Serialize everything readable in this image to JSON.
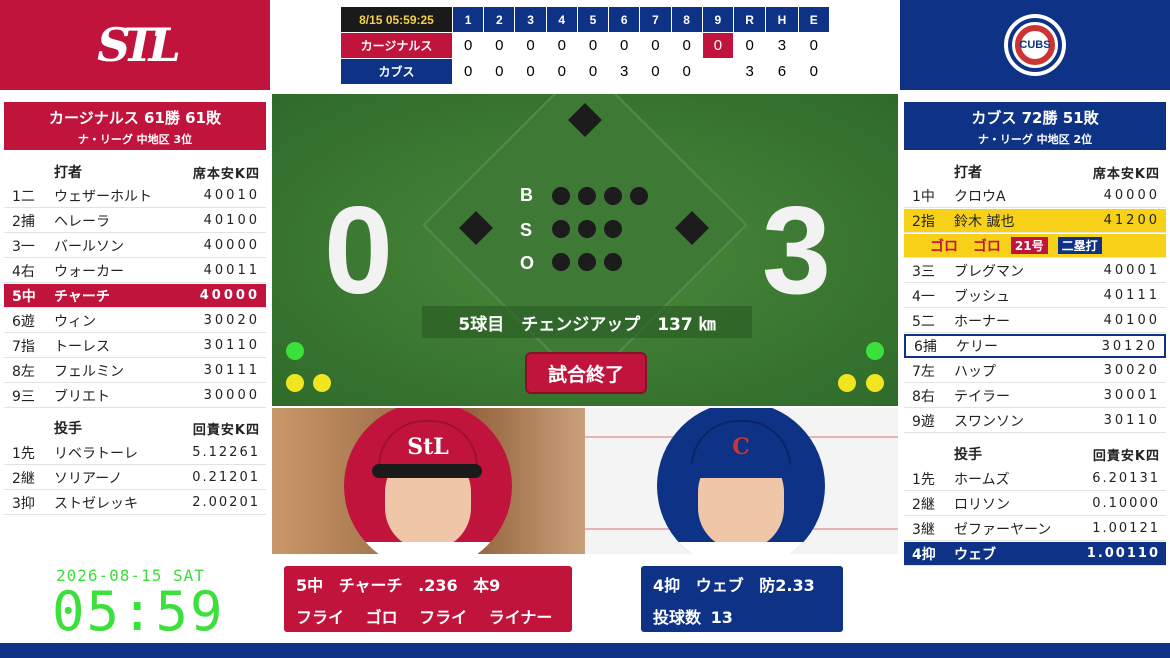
{
  "colors": {
    "cardinals_red": "#c0143c",
    "cubs_blue": "#0e3386",
    "field_green": "#3e7a35",
    "clock_green": "#3be03b",
    "highlight_yellow": "#f7d117"
  },
  "logos": {
    "left": "STL",
    "right": "CUBS"
  },
  "linescore": {
    "datetime": "8/15 05:59:25",
    "innings": [
      "1",
      "2",
      "3",
      "4",
      "5",
      "6",
      "7",
      "8",
      "9",
      "R",
      "H",
      "E"
    ],
    "rows": [
      {
        "team": "カージナルス",
        "scores": [
          "0",
          "0",
          "0",
          "0",
          "0",
          "0",
          "0",
          "0",
          "0",
          "0",
          "3",
          "0"
        ]
      },
      {
        "team": "カブス",
        "scores": [
          "0",
          "0",
          "0",
          "0",
          "0",
          "3",
          "0",
          "0",
          "",
          "3",
          "6",
          "0"
        ]
      }
    ]
  },
  "left_team": {
    "header": {
      "record": "カージナルス 61勝 61敗",
      "standing": "ナ・リーグ 中地区 3位"
    },
    "batter_header": {
      "label": "打者",
      "stats": "席本安K四"
    },
    "batters": [
      {
        "num": "1二",
        "name": "ウェザーホルト",
        "stats": "40010"
      },
      {
        "num": "2捕",
        "name": "ヘレーラ",
        "stats": "40100"
      },
      {
        "num": "3一",
        "name": "バールソン",
        "stats": "40000"
      },
      {
        "num": "4右",
        "name": "ウォーカー",
        "stats": "40011"
      },
      {
        "num": "5中",
        "name": "チャーチ",
        "stats": "40000"
      },
      {
        "num": "6遊",
        "name": "ウィン",
        "stats": "30020"
      },
      {
        "num": "7指",
        "name": "トーレス",
        "stats": "30110"
      },
      {
        "num": "8左",
        "name": "フェルミン",
        "stats": "30111"
      },
      {
        "num": "9三",
        "name": "ブリエト",
        "stats": "30000"
      }
    ],
    "pitcher_header": {
      "label": "投手",
      "stats": "回責安K四"
    },
    "pitchers": [
      {
        "num": "1先",
        "name": "リベラトーレ",
        "stats": "5.12261"
      },
      {
        "num": "2継",
        "name": "ソリアーノ",
        "stats": "0.21201"
      },
      {
        "num": "3抑",
        "name": "ストゼレッキ",
        "stats": "2.00201"
      }
    ]
  },
  "right_team": {
    "header": {
      "record": "カブス 72勝 51敗",
      "standing": "ナ・リーグ 中地区 2位"
    },
    "batter_header": {
      "label": "打者",
      "stats": "席本安K四"
    },
    "batters": [
      {
        "num": "1中",
        "name": "クロウA",
        "stats": "40000"
      },
      {
        "num": "2指",
        "name": "鈴木 誠也",
        "stats": "41200"
      },
      {
        "num": "3三",
        "name": "ブレグマン",
        "stats": "40001"
      },
      {
        "num": "4一",
        "name": "ブッシュ",
        "stats": "40111"
      },
      {
        "num": "5二",
        "name": "ホーナー",
        "stats": "40100"
      },
      {
        "num": "6捕",
        "name": "ケリー",
        "stats": "30120"
      },
      {
        "num": "7左",
        "name": "ハップ",
        "stats": "30020"
      },
      {
        "num": "8右",
        "name": "テイラー",
        "stats": "30001"
      },
      {
        "num": "9遊",
        "name": "スワンソン",
        "stats": "30110"
      }
    ],
    "suzuki_line": {
      "results": "ゴロ ゴロ",
      "hr_tag": "21号",
      "hit_tag": "二塁打"
    },
    "pitcher_header": {
      "label": "投手",
      "stats": "回責安K四"
    },
    "pitchers": [
      {
        "num": "1先",
        "name": "ホームズ",
        "stats": "6.20131"
      },
      {
        "num": "2継",
        "name": "ロリソン",
        "stats": "0.10000"
      },
      {
        "num": "3継",
        "name": "ゼファーヤーン",
        "stats": "1.00121"
      },
      {
        "num": "4抑",
        "name": "ウェブ",
        "stats": "1.00110"
      }
    ]
  },
  "field": {
    "score_away": "0",
    "score_home": "3",
    "count_labels": [
      "B",
      "S",
      "O"
    ],
    "pitch_info": "5球目　チェンジアップ　137 ㎞",
    "final_label": "試合終了"
  },
  "batter_card": {
    "line1": "5中 チャーチ .236 本9",
    "line2": "フライ ゴロ フライ ライナー"
  },
  "pitcher_card": {
    "line1": "4抑 ウェブ 防2.33",
    "line2": "投球数 13"
  },
  "clock": {
    "date": "2026-08-15 SAT",
    "time": "05:59"
  }
}
